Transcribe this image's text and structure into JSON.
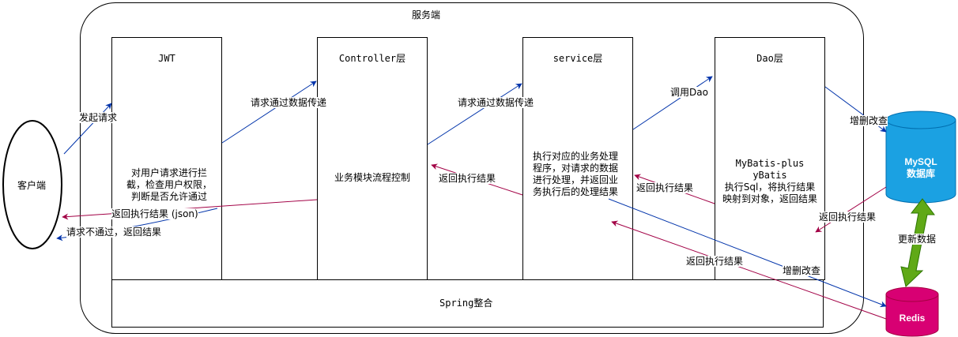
{
  "server": {
    "title": "服务端"
  },
  "client": {
    "label": "客户端"
  },
  "layers": {
    "jwt": {
      "title": "JWT",
      "desc": "对用户请求进行拦截，检查用户权限，判断是否允许通过"
    },
    "controller": {
      "title": "Controller层",
      "desc": "业务模块流程控制"
    },
    "service": {
      "title": "service层",
      "desc": "执行对应的业务处理程序，对请求的数据进行处理，并返回业务执行后的处理结果"
    },
    "dao": {
      "title": "Dao层",
      "desc_line1": "MyBatis-plus",
      "desc_line2": "yBatis",
      "desc_line3": "执行Sql，将执行结果映射到对象，返回结果"
    },
    "spring": {
      "title": "Spring整合"
    }
  },
  "storage": {
    "mysql": {
      "line1": "MySQL",
      "line2": "数据库",
      "color": "#1ba1e2"
    },
    "redis": {
      "label": "Redis",
      "color": "#d80073"
    },
    "sync_arrow_color": "#60a917"
  },
  "edges": {
    "send_request": "发起请求",
    "jwt_to_controller": "请求通过数据传递",
    "controller_to_service": "请求通过数据传递",
    "service_to_dao": "调用Dao",
    "dao_to_mysql": "增删改查",
    "mysql_return": "返回执行结果",
    "dao_return": "返回执行结果",
    "service_return": "返回执行结果",
    "controller_return": "返回执行结果 (json)",
    "jwt_reject": "请求不通过，返回结果",
    "redis_return": "返回执行结果",
    "service_to_redis": "增删改查",
    "update_data": "更新数据"
  },
  "colors": {
    "request": "#0033aa",
    "response": "#a20045"
  }
}
